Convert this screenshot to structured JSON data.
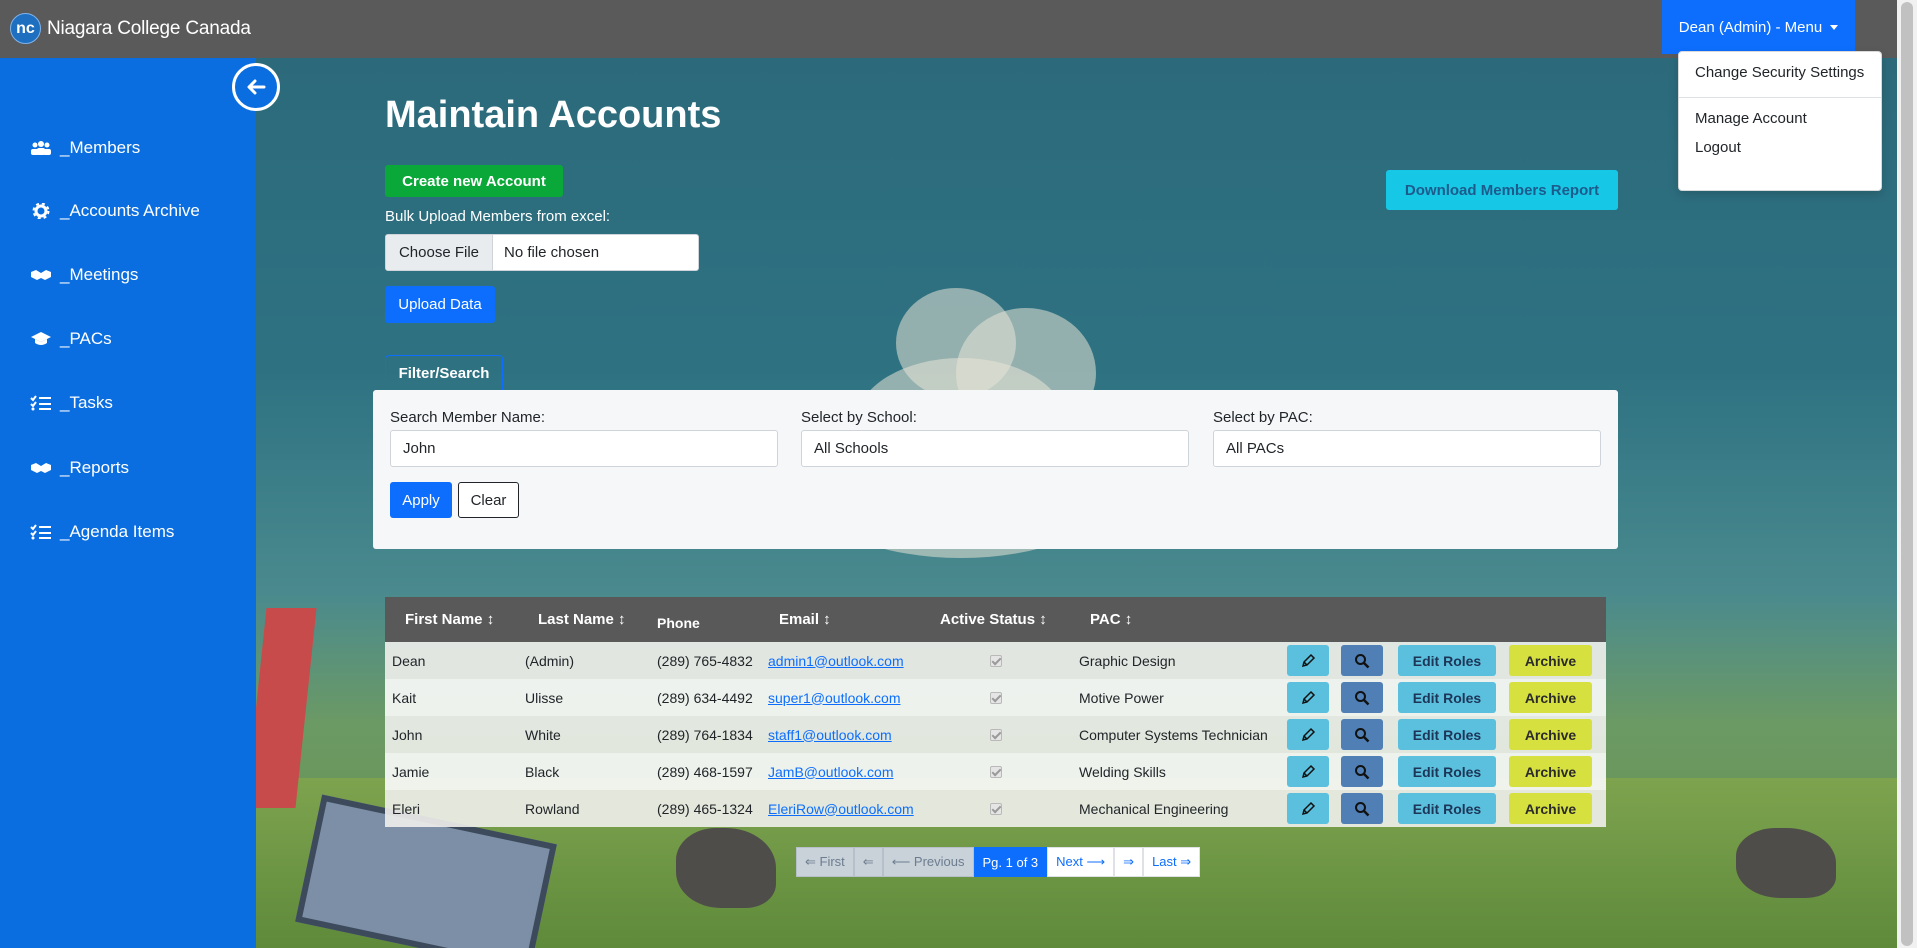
{
  "header": {
    "brand_logo": "nc",
    "brand_name": "Niagara College Canada",
    "user_menu_label": "Dean (Admin) - Menu"
  },
  "user_dropdown": {
    "items": [
      "Change Security Settings",
      "Manage Account",
      "Logout"
    ]
  },
  "sidebar": {
    "items": [
      {
        "label": "_Members",
        "icon": "users-icon"
      },
      {
        "label": "_Accounts Archive",
        "icon": "gear-icon"
      },
      {
        "label": "_Meetings",
        "icon": "handshake-icon"
      },
      {
        "label": "_PACs",
        "icon": "graduation-cap-icon"
      },
      {
        "label": "_Tasks",
        "icon": "list-check-icon"
      },
      {
        "label": "_Reports",
        "icon": "handshake-icon"
      },
      {
        "label": "_Agenda Items",
        "icon": "list-check-icon"
      }
    ]
  },
  "main": {
    "title": "Maintain Accounts",
    "create_button": "Create new Account",
    "download_button": "Download Members Report",
    "bulk_upload_label": "Bulk Upload Members from excel:",
    "file_choose_label": "Choose File",
    "file_chosen_text": "No file chosen",
    "upload_button": "Upload Data"
  },
  "filter": {
    "tab_label": "Filter/Search",
    "search_label": "Search Member Name:",
    "search_value": "John",
    "school_label": "Select by School:",
    "school_value": "All Schools",
    "pac_label": "Select by PAC:",
    "pac_value": "All PACs",
    "apply_label": "Apply",
    "clear_label": "Clear"
  },
  "table": {
    "headers": {
      "first_name": "First Name ↕",
      "last_name": "Last Name ↕",
      "phone": "Phone",
      "email": "Email ↕",
      "active": "Active Status ↕",
      "pac": "PAC ↕"
    },
    "edit_roles_label": "Edit Roles",
    "archive_label": "Archive",
    "rows": [
      {
        "first": "Dean",
        "last": "(Admin)",
        "phone": "(289) 765-4832",
        "email": "admin1@outlook.com",
        "active": true,
        "pac": "Graphic Design"
      },
      {
        "first": "Kait",
        "last": "Ulisse",
        "phone": "(289) 634-4492",
        "email": "super1@outlook.com",
        "active": true,
        "pac": "Motive Power"
      },
      {
        "first": "John",
        "last": "White",
        "phone": "(289) 764-1834",
        "email": "staff1@outlook.com",
        "active": true,
        "pac": "Computer Systems Technician"
      },
      {
        "first": "Jamie",
        "last": "Black",
        "phone": "(289) 468-1597",
        "email": "JamB@outlook.com",
        "active": true,
        "pac": "Welding Skills"
      },
      {
        "first": "Eleri",
        "last": "Rowland",
        "phone": "(289) 465-1324",
        "email": "EleriRow@outlook.com",
        "active": true,
        "pac": "Mechanical Engineering"
      }
    ]
  },
  "pagination": {
    "first": "⇐ First",
    "prev_arrow": "⇐",
    "previous": "⟵ Previous",
    "current": "Pg. 1 of 3",
    "next": "Next ⟶",
    "next_arrow": "⇒",
    "last": "Last ⇒"
  },
  "colors": {
    "header": "#5a5a5a",
    "sidebar": "#0b6ee0",
    "primary": "#0d6efd",
    "success": "#0aa839",
    "info": "#5bc0de",
    "archive": "#d6e03f"
  }
}
